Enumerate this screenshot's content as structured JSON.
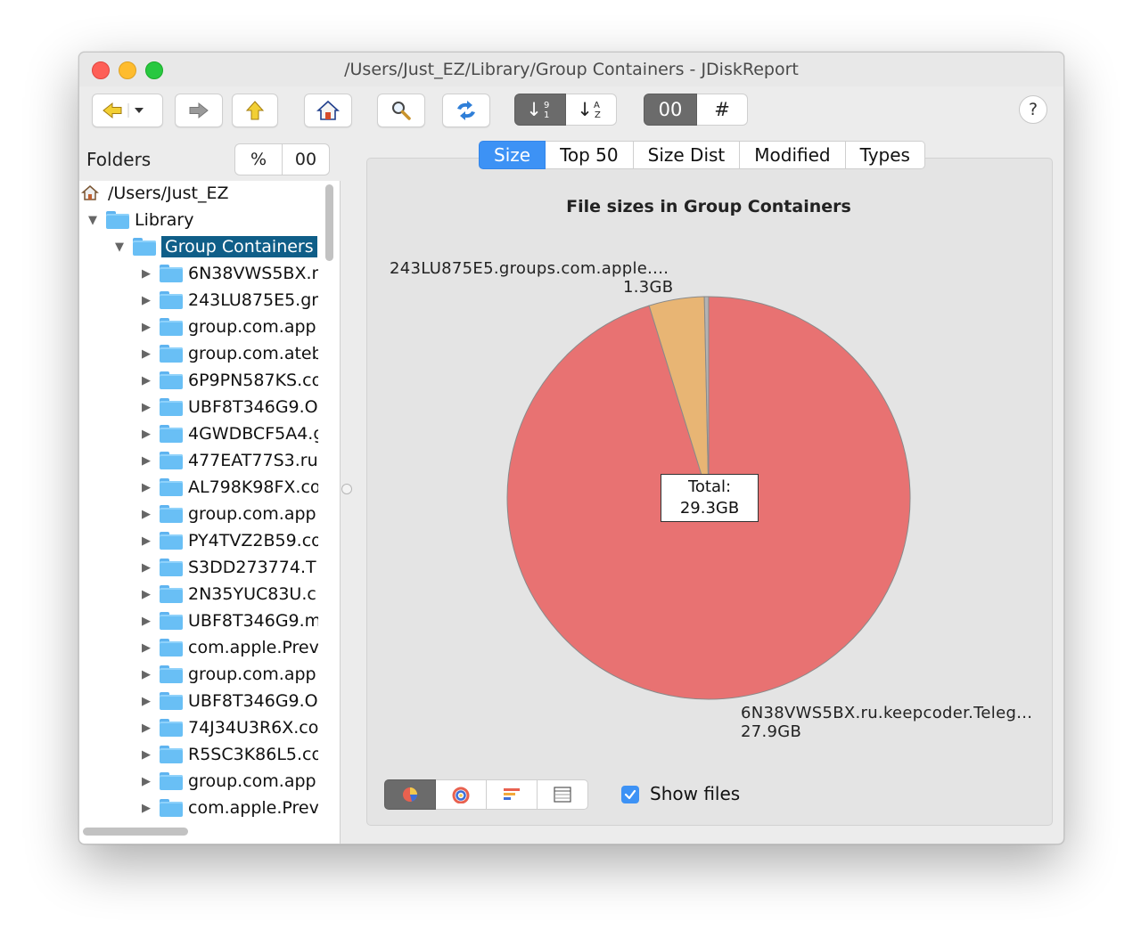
{
  "window": {
    "title": "/Users/Just_EZ/Library/Group Containers - JDiskReport"
  },
  "toolbar": {
    "sort_toggle": [
      {
        "label": "↓",
        "active": true
      },
      {
        "label": "↓",
        "active": false
      }
    ],
    "size_mode": [
      {
        "label": "00",
        "active": true
      },
      {
        "label": "#",
        "active": false
      }
    ],
    "help_label": "?"
  },
  "sidebar": {
    "header": "Folders",
    "mode_buttons": [
      {
        "label": "%"
      },
      {
        "label": "00"
      }
    ],
    "tree": [
      {
        "label": "/Users/Just_EZ",
        "level": 0,
        "icon": "home-icon"
      },
      {
        "label": "Library",
        "level": 1,
        "icon": "library-folder-icon",
        "expanded": true
      },
      {
        "label": "Group Containers",
        "level": 2,
        "icon": "folder-icon",
        "expanded": true,
        "selected": true
      },
      {
        "label": "6N38VWS5BX.r",
        "level": 3
      },
      {
        "label": "243LU875E5.gr",
        "level": 3
      },
      {
        "label": "group.com.app",
        "level": 3
      },
      {
        "label": "group.com.ateb",
        "level": 3
      },
      {
        "label": "6P9PN587KS.co",
        "level": 3
      },
      {
        "label": "UBF8T346G9.O",
        "level": 3
      },
      {
        "label": "4GWDBCF5A4.g",
        "level": 3
      },
      {
        "label": "477EAT77S3.ru",
        "level": 3
      },
      {
        "label": "AL798K98FX.co",
        "level": 3
      },
      {
        "label": "group.com.app",
        "level": 3
      },
      {
        "label": "PY4TVZ2B59.co",
        "level": 3
      },
      {
        "label": "S3DD273774.T",
        "level": 3
      },
      {
        "label": "2N35YUC83U.c",
        "level": 3
      },
      {
        "label": "UBF8T346G9.m",
        "level": 3
      },
      {
        "label": "com.apple.Prev",
        "level": 3
      },
      {
        "label": "group.com.app",
        "level": 3
      },
      {
        "label": "UBF8T346G9.O",
        "level": 3
      },
      {
        "label": "74J34U3R6X.co",
        "level": 3
      },
      {
        "label": "R5SC3K86L5.co",
        "level": 3
      },
      {
        "label": "group.com.app",
        "level": 3
      },
      {
        "label": "com.apple.Prev",
        "level": 3
      }
    ]
  },
  "main": {
    "tabs": [
      {
        "label": "Size",
        "active": true
      },
      {
        "label": "Top 50",
        "active": false
      },
      {
        "label": "Size Dist",
        "active": false
      },
      {
        "label": "Modified",
        "active": false
      },
      {
        "label": "Types",
        "active": false
      }
    ],
    "show_files_label": "Show files",
    "show_files_checked": true
  },
  "chart_data": {
    "type": "pie",
    "title": "File sizes in Group Containers",
    "center_label": "Total:",
    "center_value": "29.3GB",
    "total_gb": 29.3,
    "unit": "GB",
    "slices": [
      {
        "label": "6N38VWS5BX.ru.keepcoder.Teleg...",
        "value_label": "27.9GB",
        "value": 27.9,
        "color": "#e87272"
      },
      {
        "label": "243LU875E5.groups.com.apple....",
        "value_label": "1.3GB",
        "value": 1.3,
        "color": "#e8b574"
      },
      {
        "label": "",
        "value_label": "",
        "value": 0.1,
        "color": "#b3b3b3"
      }
    ]
  }
}
